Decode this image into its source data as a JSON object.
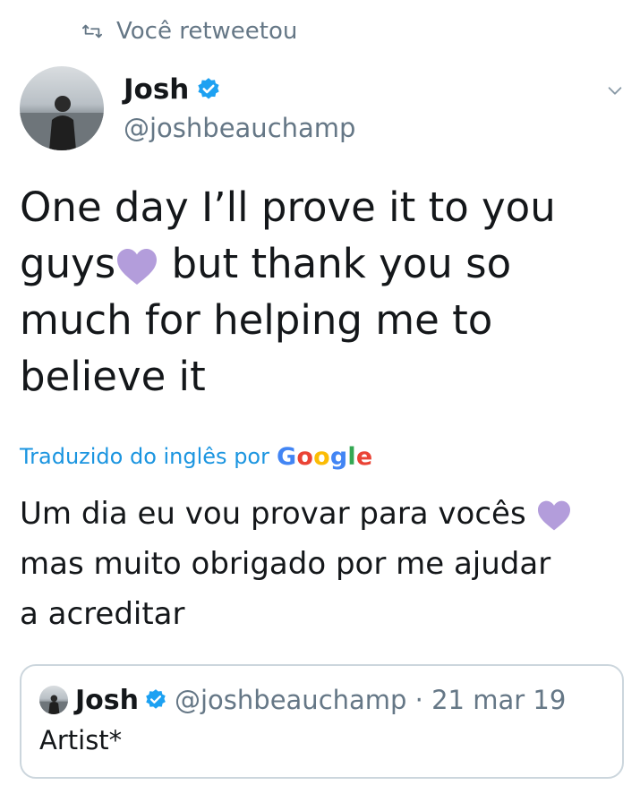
{
  "retweet": {
    "label": "Você retweetou",
    "icon": "retweet-icon"
  },
  "author": {
    "name": "Josh",
    "handle": "@joshbeauchamp",
    "verified": true
  },
  "tweet": {
    "line1": "One day I’ll prove it to you",
    "line2a": "guys",
    "line2b": " but thank you so",
    "line3": "much for helping me to",
    "line4": "believe it",
    "emoji": "purple-heart"
  },
  "translation": {
    "label": "Traduzido do inglês por",
    "brand": "Google",
    "brand_letters": [
      "G",
      "o",
      "o",
      "g",
      "l",
      "e"
    ],
    "line1": "Um dia eu vou provar para vocês ",
    "line2": "mas muito obrigado por me ajudar",
    "line3": "a acreditar"
  },
  "quoted": {
    "name": "Josh",
    "handle": "@joshbeauchamp · 21 mar 19",
    "text": "Artist*",
    "verified": true
  },
  "colors": {
    "accent": "#1b95e0",
    "verified": "#1da1f2",
    "heart": "#b39ddb",
    "muted": "#657786",
    "border": "#ccd6dd"
  }
}
